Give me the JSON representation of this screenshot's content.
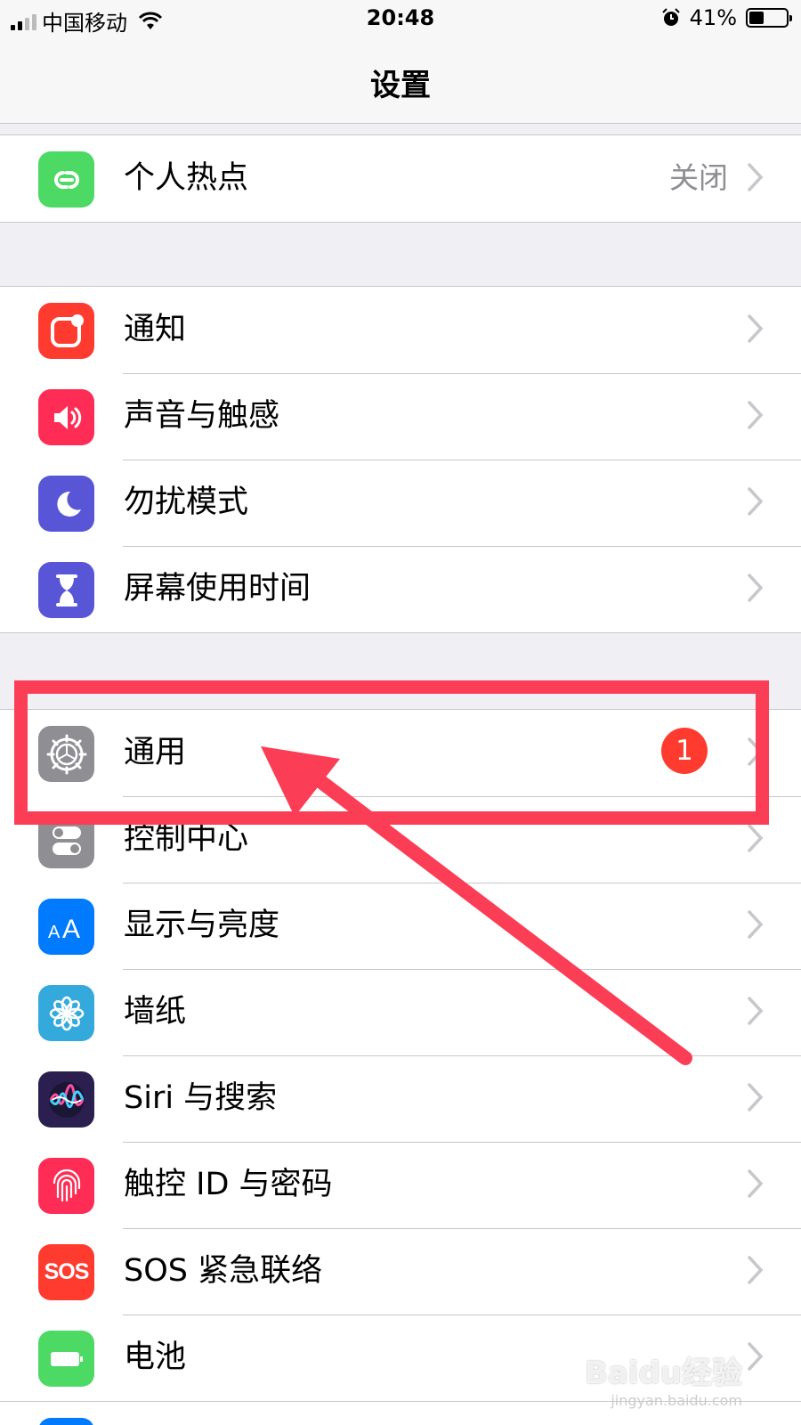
{
  "status_bar": {
    "carrier": "中国移动",
    "time": "20:48",
    "battery_percent": "41%",
    "battery_level": 0.41,
    "signal_bars_active": 2
  },
  "nav": {
    "title": "设置"
  },
  "groups": [
    {
      "rows": [
        {
          "label": "个人热点",
          "value": "关闭",
          "icon": "personal-hotspot-icon",
          "icon_color": "#4cd964"
        }
      ]
    },
    {
      "rows": [
        {
          "label": "通知",
          "icon": "notifications-icon",
          "icon_color": "#ff3b30"
        },
        {
          "label": "声音与触感",
          "icon": "sound-icon",
          "icon_color": "#ff2d55"
        },
        {
          "label": "勿扰模式",
          "icon": "moon-icon",
          "icon_color": "#5856d6"
        },
        {
          "label": "屏幕使用时间",
          "icon": "hourglass-icon",
          "icon_color": "#5856d6"
        }
      ]
    },
    {
      "rows": [
        {
          "label": "通用",
          "badge": "1",
          "icon": "gear-icon",
          "icon_color": "#8e8e93"
        },
        {
          "label": "控制中心",
          "icon": "toggles-icon",
          "icon_color": "#8e8e93"
        },
        {
          "label": "显示与亮度",
          "icon": "text-size-icon",
          "icon_color": "#007aff"
        },
        {
          "label": "墙纸",
          "icon": "flower-icon",
          "icon_color": "#34aadc"
        },
        {
          "label": "Siri 与搜索",
          "icon": "siri-icon",
          "icon_color": "#2b1f4f"
        },
        {
          "label": "触控 ID 与密码",
          "icon": "fingerprint-icon",
          "icon_color": "#ff2d55"
        },
        {
          "label": "SOS 紧急联络",
          "icon_text": "SOS",
          "icon": "sos-icon",
          "icon_color": "#ff3b30"
        },
        {
          "label": "电池",
          "icon": "battery-icon",
          "icon_color": "#4cd964"
        }
      ]
    }
  ],
  "annotation": {
    "color": "#fb3d55"
  },
  "watermark": {
    "logo": "Baidu经验",
    "url": "jingyan.baidu.com"
  }
}
